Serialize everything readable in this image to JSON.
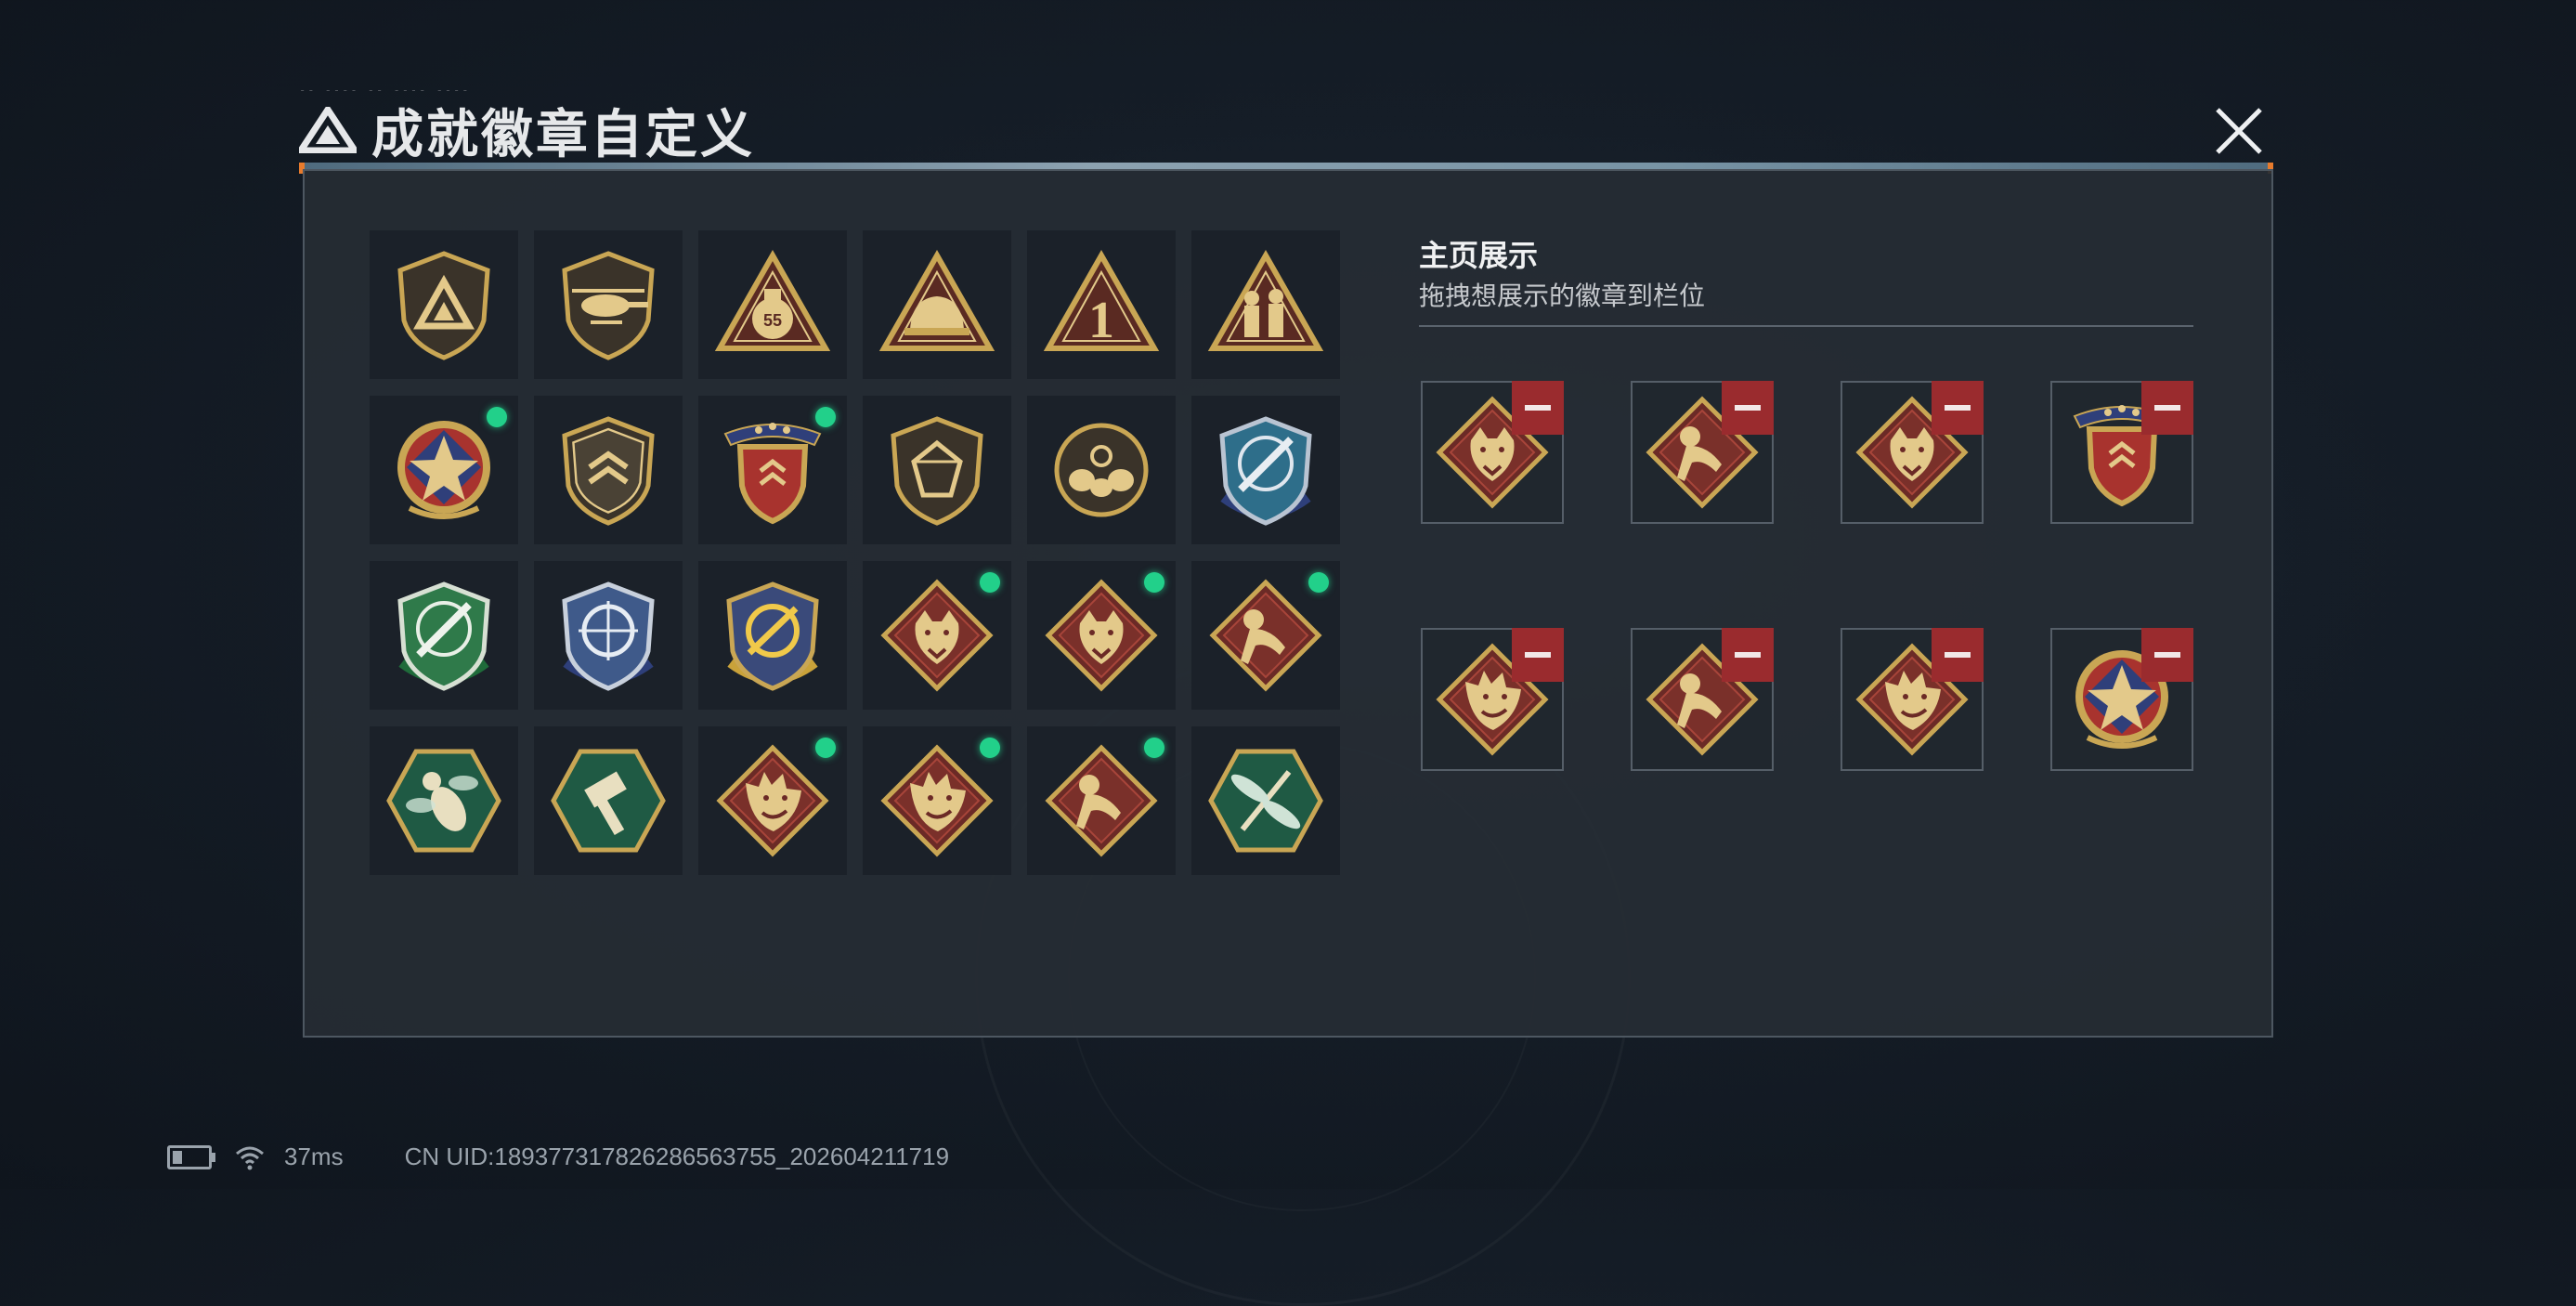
{
  "window": {
    "title": "成就徽章自定义",
    "tiny_caption": "-- ---- -- ---- ----"
  },
  "panel_right": {
    "heading": "主页展示",
    "subtitle": "拖拽想展示的徽章到栏位"
  },
  "badges": [
    {
      "icon": "triangle-logo-shield-icon",
      "new": false
    },
    {
      "icon": "helicopter-shield-icon",
      "new": false
    },
    {
      "icon": "money-bag-triangle-icon",
      "new": false
    },
    {
      "icon": "helmet-triangle-icon",
      "new": false
    },
    {
      "icon": "number-one-triangle-icon",
      "new": false
    },
    {
      "icon": "soldiers-triangle-icon",
      "new": false
    },
    {
      "icon": "star-medal-icon",
      "new": true
    },
    {
      "icon": "chevron-shield-icon",
      "new": false
    },
    {
      "icon": "star-ribbon-shield-icon",
      "new": true
    },
    {
      "icon": "gem-shield-icon",
      "new": false
    },
    {
      "icon": "round-crest-icon",
      "new": false
    },
    {
      "icon": "blue-rifle-shield-icon",
      "new": false
    },
    {
      "icon": "green-rifle-shield-icon",
      "new": false
    },
    {
      "icon": "blue-scope-shield-icon",
      "new": false
    },
    {
      "icon": "gold-scope-shield-icon",
      "new": false
    },
    {
      "icon": "wolf-diamond-icon",
      "new": true
    },
    {
      "icon": "wolf-diamond-icon",
      "new": true
    },
    {
      "icon": "monkey-diamond-icon",
      "new": true
    },
    {
      "icon": "hornet-hexagon-icon",
      "new": false
    },
    {
      "icon": "hammer-hexagon-icon",
      "new": false
    },
    {
      "icon": "dragon-diamond-icon",
      "new": true
    },
    {
      "icon": "dragon-diamond-icon",
      "new": true
    },
    {
      "icon": "monkey-diamond-icon",
      "new": true
    },
    {
      "icon": "dragonfly-hexagon-icon",
      "new": false
    }
  ],
  "slots": [
    {
      "icon": "wolf-diamond-icon"
    },
    {
      "icon": "monkey-diamond-icon"
    },
    {
      "icon": "wolf-diamond-icon"
    },
    {
      "icon": "star-ribbon-shield-icon"
    },
    {
      "icon": "dragon-diamond-icon"
    },
    {
      "icon": "monkey-diamond-icon"
    },
    {
      "icon": "dragon-diamond-icon"
    },
    {
      "icon": "star-medal-icon"
    }
  ],
  "colors": {
    "new_dot": "#22d08a",
    "remove": "#9a2b2e",
    "accent": "#e77b2d",
    "gold": "#c9a654"
  },
  "status": {
    "latency": "37ms",
    "uid": "CN UID:189377317826286563755_202604211719"
  }
}
